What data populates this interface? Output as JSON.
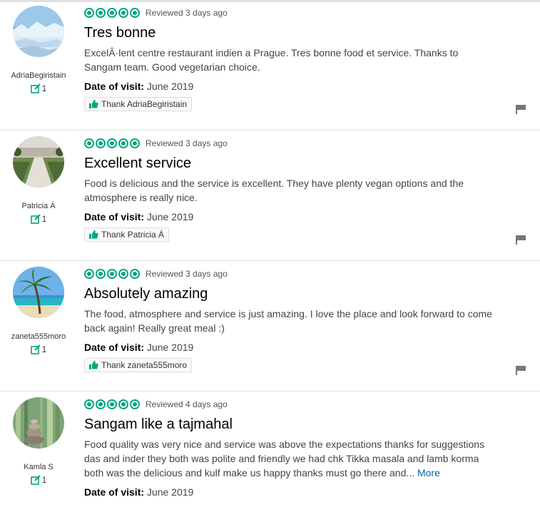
{
  "reviews": [
    {
      "username": "AdriaBegiristain",
      "contributions": "1",
      "reviewed": "Reviewed 3 days ago",
      "title": "Tres bonne",
      "body": "ExcelÂ·lent centre restaurant indien a Prague. Tres bonne food et service. Thanks to Sangam team. Good vegetarian choice.",
      "more": "",
      "visit_label": "Date of visit:",
      "visit_date": "June 2019",
      "thank": "Thank AdriaBegiristain",
      "avatar_icon": "glacier-photo-icon"
    },
    {
      "username": "Patricia Á",
      "contributions": "1",
      "reviewed": "Reviewed 3 days ago",
      "title": "Excellent service",
      "body": "Food is delicious and the service is excellent. They have plenty vegan options and the atmosphere is really nice.",
      "more": "",
      "visit_label": "Date of visit:",
      "visit_date": "June 2019",
      "thank": "Thank Patricia Á",
      "avatar_icon": "garden-photo-icon"
    },
    {
      "username": "zaneta555moro",
      "contributions": "1",
      "reviewed": "Reviewed 3 days ago",
      "title": "Absolutely amazing",
      "body": "The food, atmosphere and service is just amazing. I love the place and look forward to come back again! Really great meal :)",
      "more": "",
      "visit_label": "Date of visit:",
      "visit_date": "June 2019",
      "thank": "Thank zaneta555moro",
      "avatar_icon": "palm-beach-photo-icon"
    },
    {
      "username": "Kamla S",
      "contributions": "1",
      "reviewed": "Reviewed 4 days ago",
      "title": "Sangam like a tajmahal",
      "body": "Food quality was very nice and service was above the expectations thanks for suggestions das and inder they both was polite and friendly we had chk Tikka masala and lamb korma both was the delicious and kulf make us happy thanks must go there and...",
      "more": "More",
      "visit_label": "Date of visit:",
      "visit_date": "June 2019",
      "thank": "",
      "avatar_icon": "bamboo-stones-photo-icon"
    }
  ],
  "colors": {
    "bubble": "#00a680",
    "link": "#006699",
    "flag": "#777777"
  }
}
